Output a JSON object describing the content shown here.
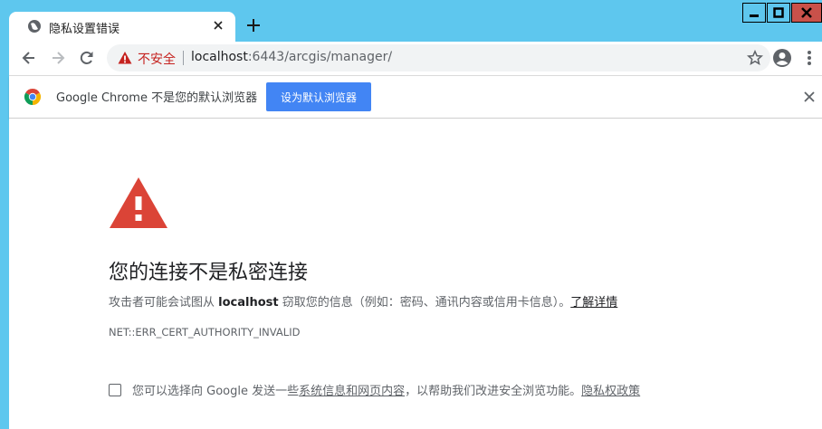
{
  "tab": {
    "title": "隐私设置错误"
  },
  "omnibox": {
    "security_label": "不安全",
    "url_host": "localhost",
    "url_rest": ":6443/arcgis/manager/"
  },
  "infobar": {
    "text": "Google Chrome 不是您的默认浏览器",
    "button": "设为默认浏览器"
  },
  "interstitial": {
    "heading": "您的连接不是私密连接",
    "desc_pre": "攻击者可能会试图从 ",
    "desc_host": "localhost",
    "desc_post": " 窃取您的信息（例如：密码、通讯内容或信用卡信息）。",
    "learn_more": "了解详情",
    "error_code": "NET::ERR_CERT_AUTHORITY_INVALID",
    "optin_pre": "您可以选择向 Google 发送一些",
    "optin_link": "系统信息和网页内容",
    "optin_mid": "，以帮助我们改进安全浏览功能。",
    "privacy_link": "隐私权政策"
  },
  "colors": {
    "titlebar": "#5ec7ee",
    "warning_red": "#db4437",
    "button_blue": "#4285f4"
  },
  "icons": [
    "globe-icon",
    "close-icon",
    "plus-icon",
    "minimize-icon",
    "maximize-icon",
    "window-close-icon",
    "back-icon",
    "forward-icon",
    "reload-icon",
    "warning-icon",
    "star-icon",
    "account-icon",
    "menu-icon",
    "chrome-logo-icon"
  ]
}
